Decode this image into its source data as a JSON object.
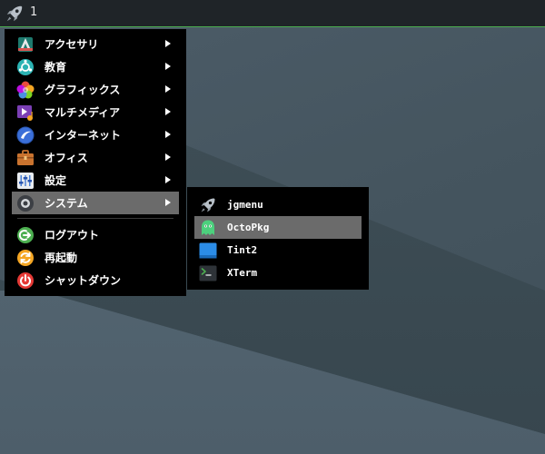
{
  "panel": {
    "workspace_label": "1",
    "launcher_icon": "rocket-icon",
    "accent_color": "#4caf50"
  },
  "main_menu": {
    "categories": [
      {
        "label": "アクセサリ",
        "icon": "accessories-icon",
        "has_submenu": true
      },
      {
        "label": "教育",
        "icon": "education-icon",
        "has_submenu": true
      },
      {
        "label": "グラフィックス",
        "icon": "graphics-icon",
        "has_submenu": true
      },
      {
        "label": "マルチメディア",
        "icon": "multimedia-icon",
        "has_submenu": true
      },
      {
        "label": "インターネット",
        "icon": "internet-icon",
        "has_submenu": true
      },
      {
        "label": "オフィス",
        "icon": "office-icon",
        "has_submenu": true
      },
      {
        "label": "設定",
        "icon": "settings-icon",
        "has_submenu": true
      },
      {
        "label": "システム",
        "icon": "system-icon",
        "has_submenu": true,
        "selected": true
      }
    ],
    "session": [
      {
        "label": "ログアウト",
        "icon": "logout-icon"
      },
      {
        "label": "再起動",
        "icon": "reboot-icon"
      },
      {
        "label": "シャットダウン",
        "icon": "shutdown-icon"
      }
    ]
  },
  "system_submenu": {
    "items": [
      {
        "label": "jgmenu",
        "icon": "rocket-icon"
      },
      {
        "label": "OctoPkg",
        "icon": "octopi-icon",
        "selected": true
      },
      {
        "label": "Tint2",
        "icon": "tint2-icon"
      },
      {
        "label": "XTerm",
        "icon": "terminal-icon"
      }
    ]
  }
}
